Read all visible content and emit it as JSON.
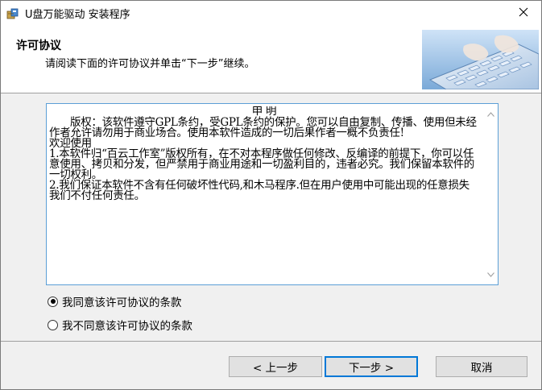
{
  "window": {
    "title": "U盘万能驱动 安装程序",
    "app_icon": "installer-package-icon",
    "close_icon": "close-icon"
  },
  "header": {
    "title": "许可协议",
    "subtitle": "请阅读下面的许可协议并单击“下一步”继续。",
    "image": "keyboard-typing-image"
  },
  "license": {
    "heading": "申 明",
    "paragraphs": [
      "版权：该软件遵守GPL条约，受GPL条约的保护。您可以自由复制、传播、使用但未经作者允许请勿用于商业场合。使用本软件造成的一切后果作者一概不负责任!",
      "欢迎使用",
      "1.本软件归“百云工作室”版权所有，在不对本程序做任何修改、反编译的前提下，你可以任意使用、拷贝和分发，但严禁用于商业用途和一切盈利目的，违者必究。我们保留本软件的一切权利。",
      "2.我们保证本软件不含有任何破坏性代码,和木马程序.但在用户使用中可能出现的任意损失我们不付任何责任。"
    ]
  },
  "options": {
    "agree": {
      "label": "我同意该许可协议的条款",
      "checked": true
    },
    "disagree": {
      "label": "我不同意该许可协议的条款",
      "checked": false
    }
  },
  "buttons": {
    "back": "< 上一步",
    "next": "下一步 >",
    "cancel": "取消"
  },
  "colors": {
    "accent": "#0078d7",
    "box_border": "#5c9fd6",
    "background": "#f0f0f0"
  }
}
